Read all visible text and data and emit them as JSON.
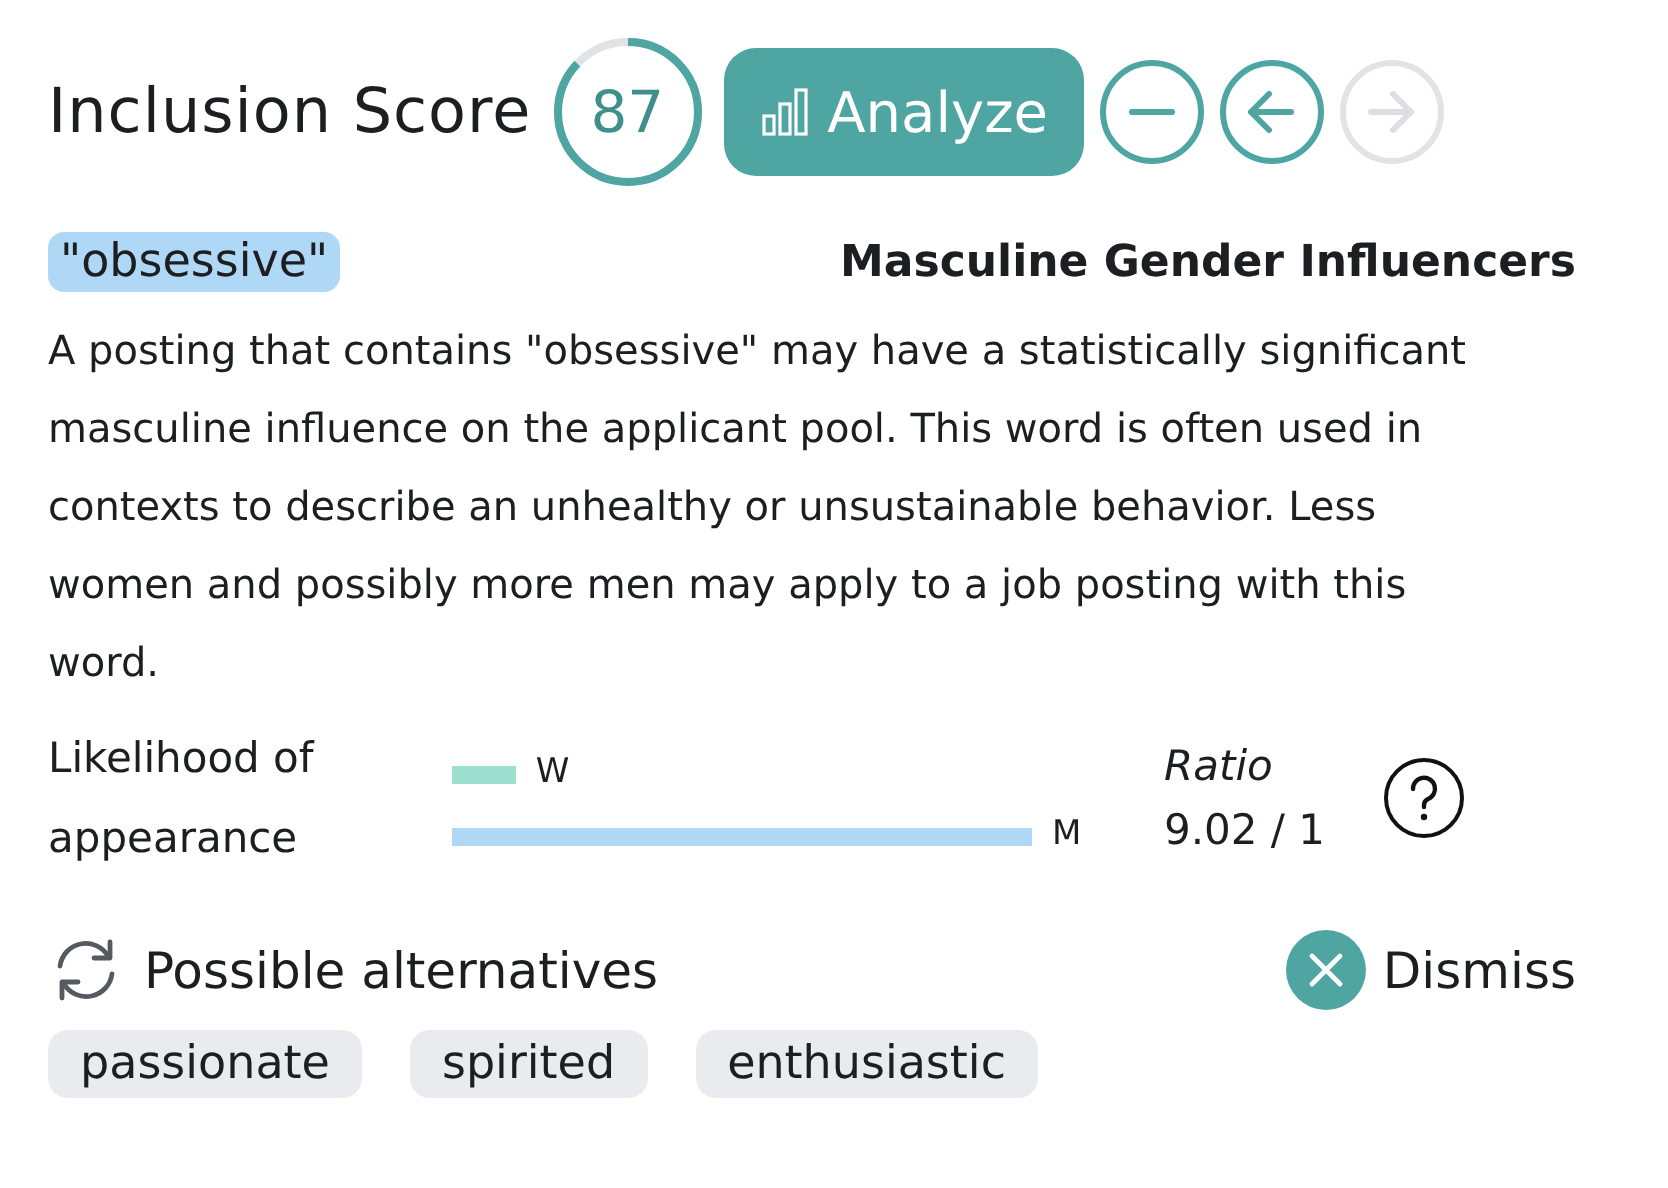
{
  "header": {
    "title": "Inclusion Score",
    "score": {
      "value": "87"
    },
    "analyze_button": "Analyze",
    "nav_buttons": [
      {
        "kind": "minus",
        "disabled": false
      },
      {
        "kind": "back",
        "disabled": false
      },
      {
        "kind": "forward",
        "disabled": true
      }
    ]
  },
  "term": {
    "word": "\"obsessive\"",
    "category": "Masculine Gender Influencers",
    "description": "A posting that contains \"obsessive\" may have a statistically significant masculine influence on the applicant pool. This word is often used in contexts to describe an unhealthy or unsustainable behavior. Less women and possibly more men may apply to a job posting with this word."
  },
  "likelihood": {
    "label": "Likelihood of appearance",
    "bars": [
      {
        "name": "W",
        "color": "#9ee0d0"
      },
      {
        "name": "M",
        "color": "#aed8f6"
      }
    ],
    "ratio_label": "Ratio",
    "ratio": "9.02 / 1"
  },
  "alternatives": {
    "title": "Possible alternatives",
    "dismiss": "Dismiss",
    "options": [
      "passionate",
      "spirited",
      "enthusiastic"
    ]
  }
}
